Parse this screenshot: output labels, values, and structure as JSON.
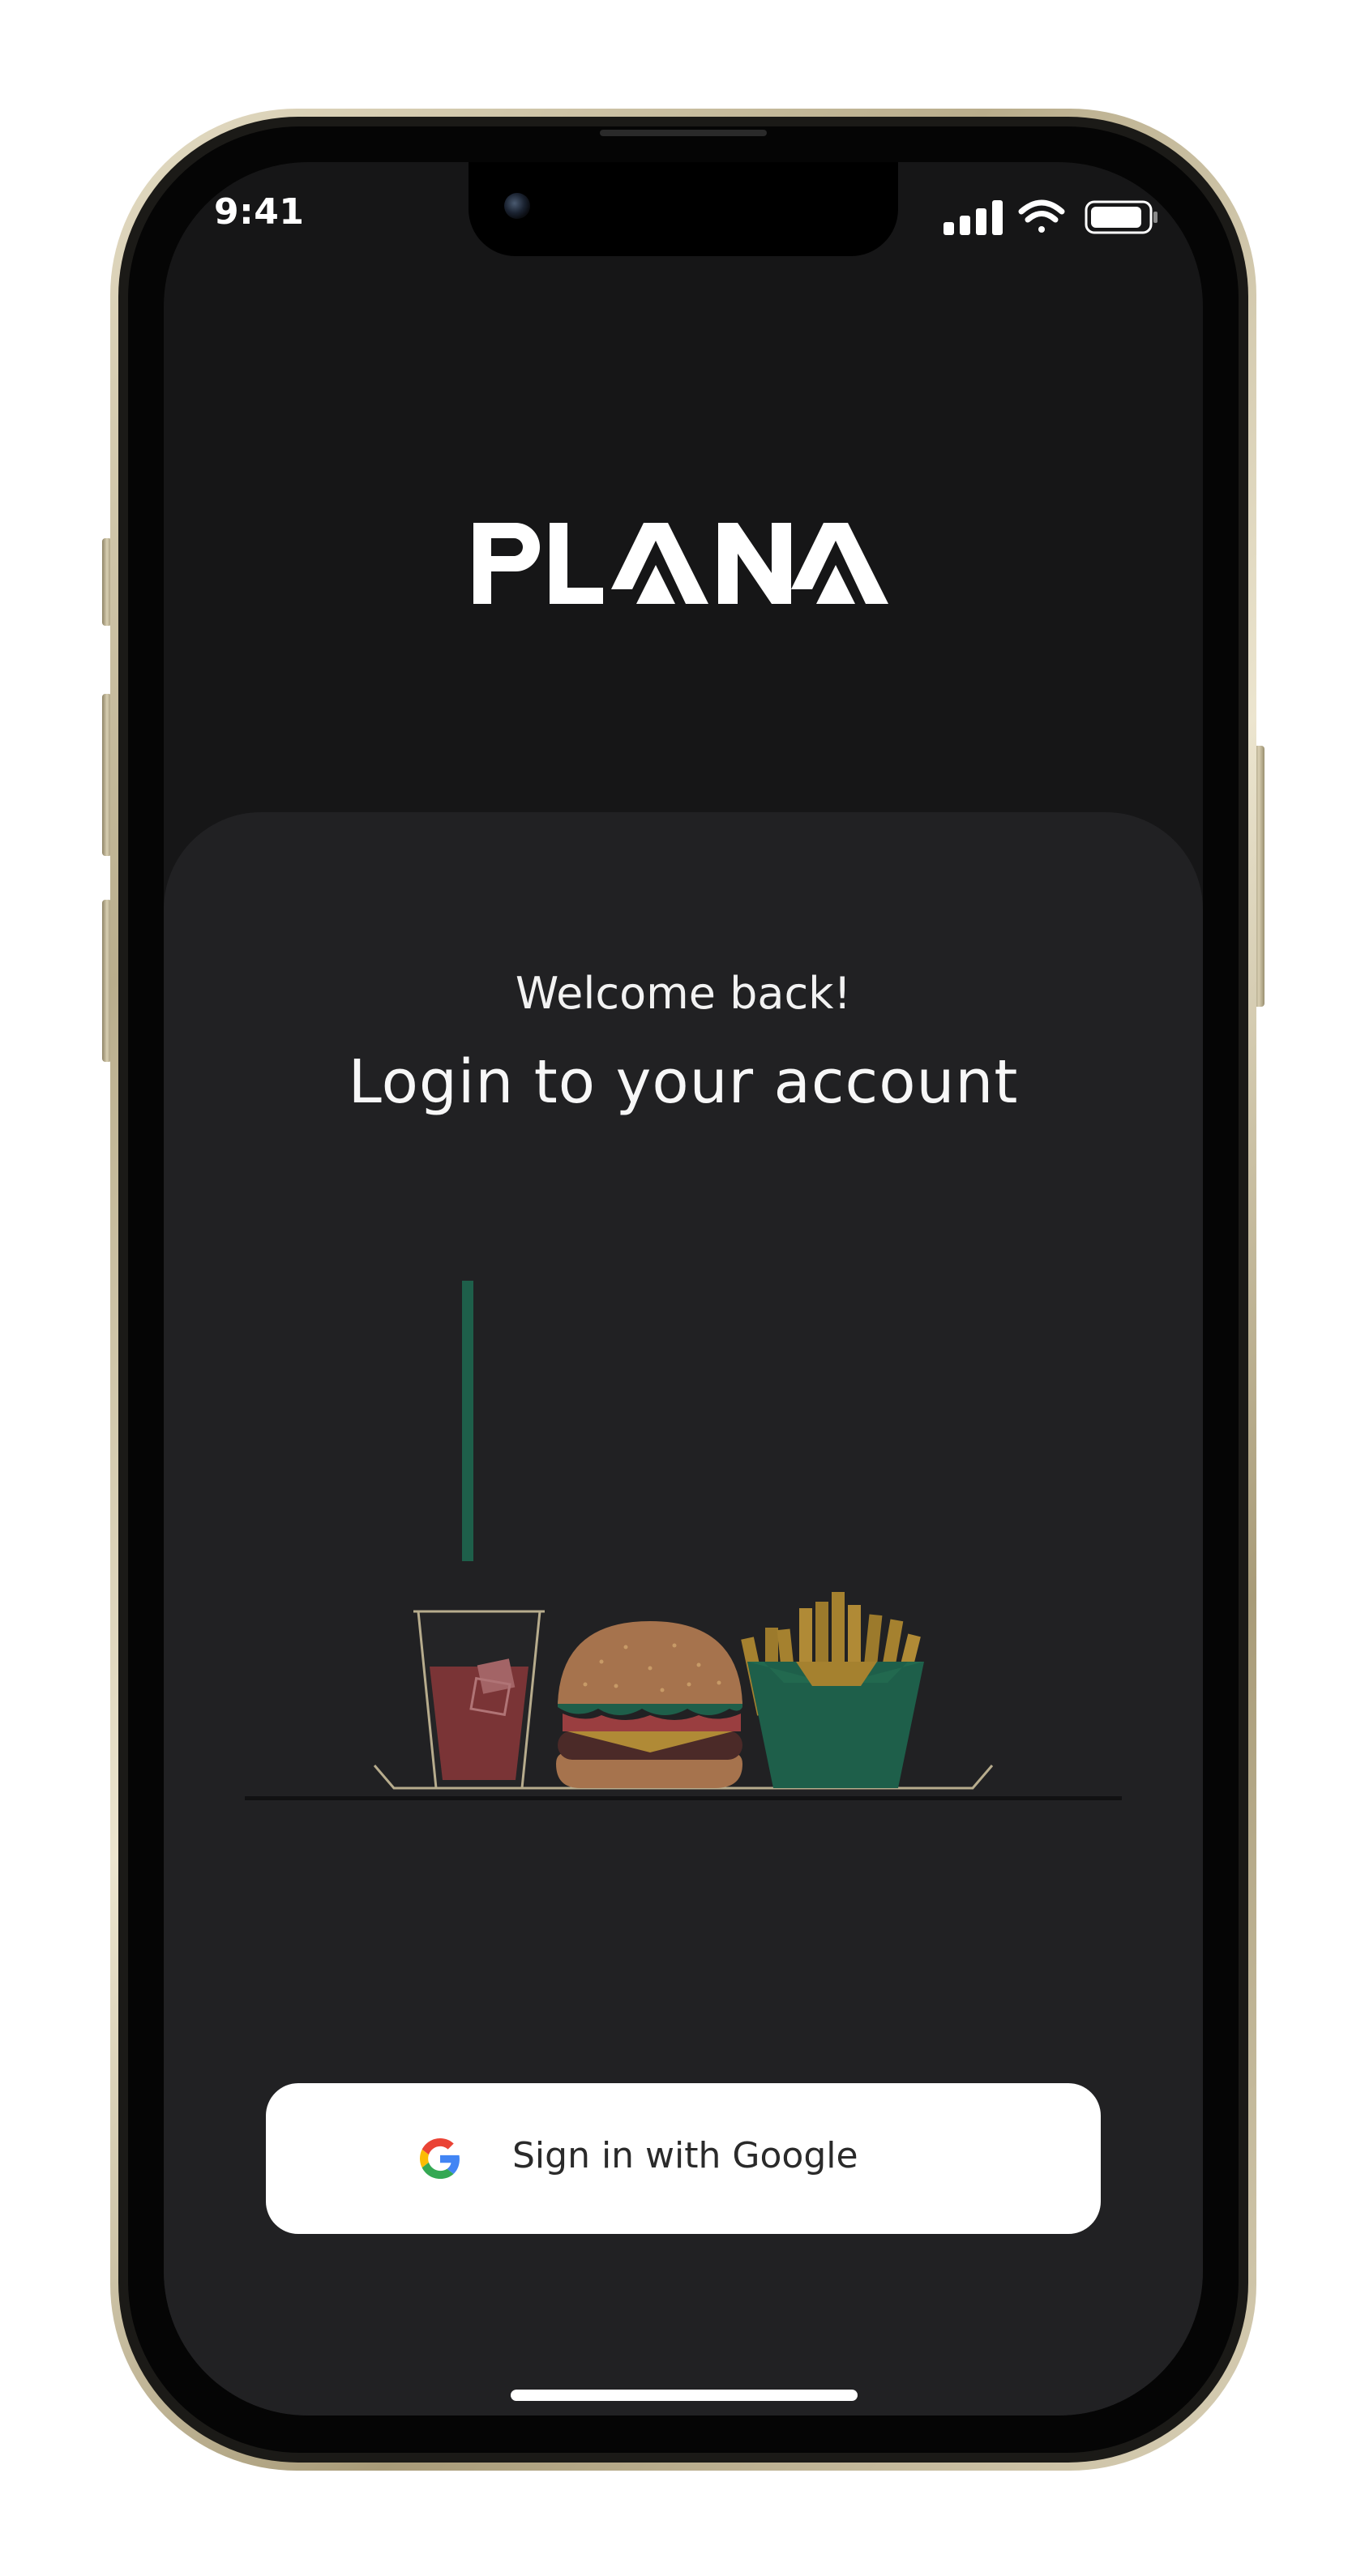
{
  "status_bar": {
    "time": "9:41",
    "icons": [
      "signal-icon",
      "wifi-icon",
      "battery-icon"
    ]
  },
  "brand": {
    "logo_text": "PLANA"
  },
  "login": {
    "welcome_text": "Welcome back!",
    "headline": "Login to your account",
    "illustration": "fast-food-illustration"
  },
  "google_button": {
    "label": "Sign in with Google",
    "icon": "google-icon"
  },
  "colors": {
    "background": "#161617",
    "card": "#212123",
    "button": "#ffffff",
    "accent_green": "#1e5f4a",
    "drink_red": "#7a3436",
    "fries_gold": "#a5812f"
  }
}
